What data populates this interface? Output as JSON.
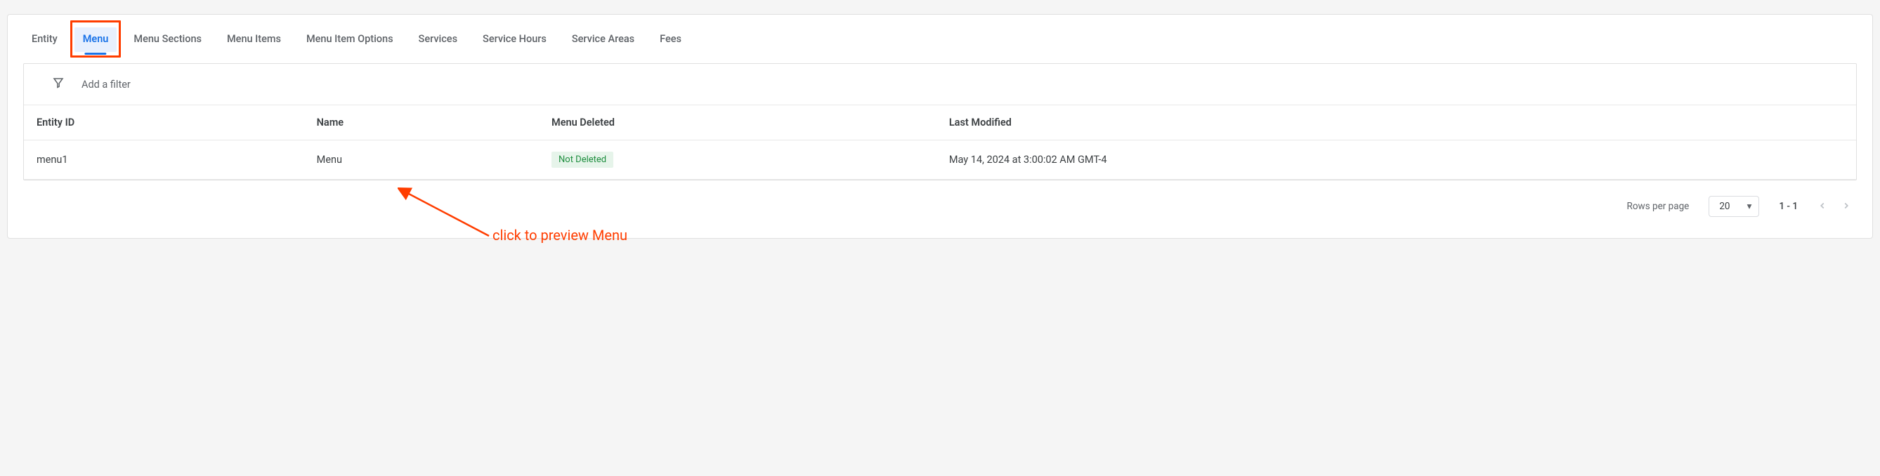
{
  "tabs": [
    {
      "name": "entity",
      "label": "Entity",
      "active": false
    },
    {
      "name": "menu",
      "label": "Menu",
      "active": true
    },
    {
      "name": "menu-sections",
      "label": "Menu Sections",
      "active": false
    },
    {
      "name": "menu-items",
      "label": "Menu Items",
      "active": false
    },
    {
      "name": "menu-item-options",
      "label": "Menu Item Options",
      "active": false
    },
    {
      "name": "services",
      "label": "Services",
      "active": false
    },
    {
      "name": "service-hours",
      "label": "Service Hours",
      "active": false
    },
    {
      "name": "service-areas",
      "label": "Service Areas",
      "active": false
    },
    {
      "name": "fees",
      "label": "Fees",
      "active": false
    }
  ],
  "filter": {
    "placeholder": "Add a filter"
  },
  "table": {
    "headers": {
      "entity_id": "Entity ID",
      "name": "Name",
      "menu_deleted": "Menu Deleted",
      "last_modified": "Last Modified"
    },
    "rows": [
      {
        "entity_id": "menu1",
        "name": "Menu",
        "menu_deleted": "Not Deleted",
        "last_modified": "May 14, 2024 at 3:00:02 AM GMT-4"
      }
    ]
  },
  "pager": {
    "label": "Rows per page",
    "per_page": "20",
    "range": "1 - 1"
  },
  "annotation": {
    "text": "click to preview Menu"
  }
}
